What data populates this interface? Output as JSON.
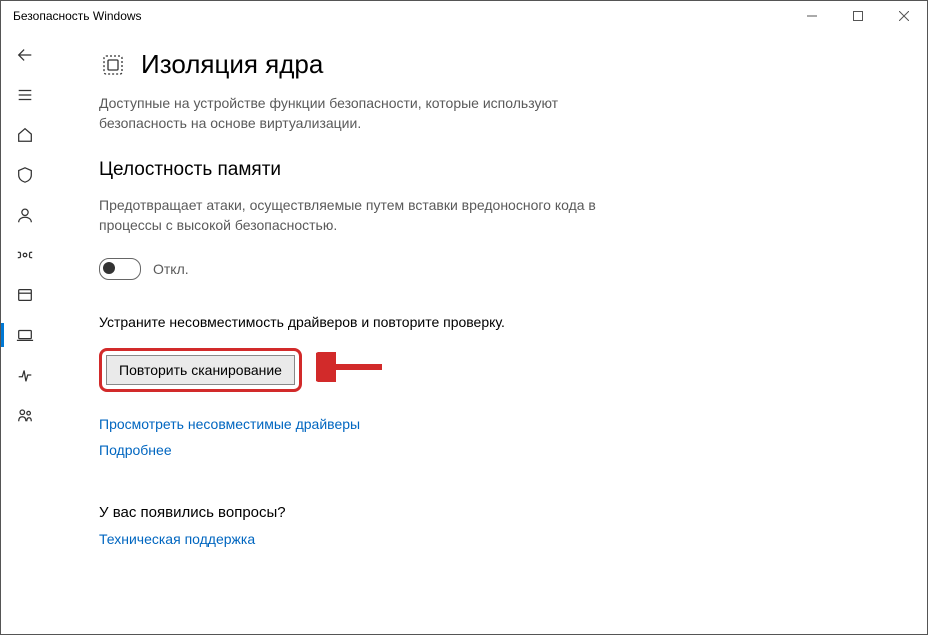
{
  "window": {
    "title": "Безопасность Windows"
  },
  "page": {
    "title": "Изоляция ядра",
    "description": "Доступные на устройстве функции безопасности, которые используют безопасность на основе виртуализации."
  },
  "memory_integrity": {
    "title": "Целостность памяти",
    "description": "Предотвращает атаки, осуществляемые путем вставки вредоносного кода в процессы с высокой безопасностью.",
    "toggle_state_label": "Откл."
  },
  "fix": {
    "text": "Устраните несовместимость драйверов и повторите проверку.",
    "rescan_button": "Повторить сканирование"
  },
  "links": {
    "incompatible": "Просмотреть несовместимые драйверы",
    "more": "Подробнее"
  },
  "help": {
    "heading": "У вас появились вопросы?",
    "support_link": "Техническая поддержка"
  }
}
